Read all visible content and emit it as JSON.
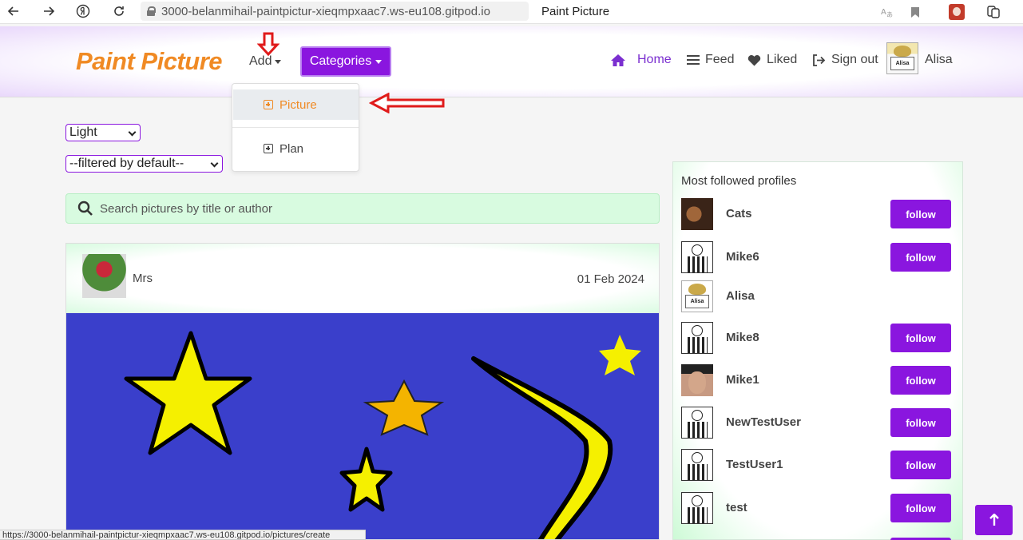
{
  "browser": {
    "url": "3000-belanmihail-paintpictur-xieqmpxaac7.ws-eu108.gitpod.io",
    "tab_title": "Paint Picture",
    "status_url": "https://3000-belanmihail-paintpictur-xieqmpxaac7.ws-eu108.gitpod.io/pictures/create"
  },
  "header": {
    "brand": "Paint Picture",
    "add_label": "Add",
    "categories_label": "Categories",
    "nav": {
      "home": "Home",
      "feed": "Feed",
      "liked": "Liked",
      "signout": "Sign out",
      "username": "Alisa",
      "avatar_sign": "Alisa"
    }
  },
  "add_dropdown": {
    "items": [
      {
        "label": "Picture",
        "active": true
      },
      {
        "label": "Plan",
        "active": false
      }
    ]
  },
  "controls": {
    "theme": "Light",
    "filter": "--filtered by default--",
    "search_placeholder": "Search pictures by title or author"
  },
  "post": {
    "author": "Mrs",
    "date": "01 Feb 2024"
  },
  "sidebar": {
    "title": "Most followed profiles",
    "follow_label": "follow",
    "profiles": [
      {
        "name": "Cats",
        "avatar": "cat",
        "follow": true
      },
      {
        "name": "Mike6",
        "avatar": "stripes",
        "follow": true
      },
      {
        "name": "Alisa",
        "avatar": "alisa",
        "follow": false
      },
      {
        "name": "Mike8",
        "avatar": "stripes",
        "follow": true
      },
      {
        "name": "Mike1",
        "avatar": "face",
        "follow": true
      },
      {
        "name": "NewTestUser",
        "avatar": "stripes",
        "follow": true
      },
      {
        "name": "TestUser1",
        "avatar": "stripes",
        "follow": true
      },
      {
        "name": "test",
        "avatar": "stripes",
        "follow": true
      }
    ]
  },
  "colors": {
    "brand": "#f08a24",
    "accent": "#8a16df",
    "search_bg": "#d8fbe0",
    "annotation": "#e01b1b"
  }
}
